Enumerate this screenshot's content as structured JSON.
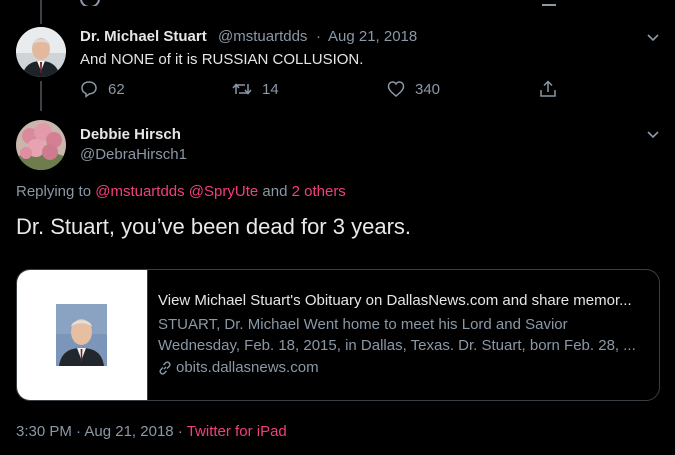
{
  "top_reply": {
    "name": "Dr. Michael Stuart",
    "handle": "@mstuartdds",
    "separator": "·",
    "date": "Aug 21, 2018",
    "text": "And NONE of it is RUSSIAN COLLUSION.",
    "reply_count": "62",
    "retweet_count": "14",
    "like_count": "340"
  },
  "main_tweet": {
    "name": "Debbie Hirsch",
    "handle": "@DebraHirsch1",
    "replying_prefix": "Replying to",
    "replying_users": "@mstuartdds @SpryUte",
    "replying_and": "and",
    "replying_others": "2 others",
    "text": "Dr. Stuart, you’ve been dead for 3 years.",
    "card": {
      "title": "View Michael Stuart's Obituary on DallasNews.com and share memor...",
      "desc_line1": "STUART, Dr. Michael Went home to meet his Lord and Savior",
      "desc_line2": "Wednesday, Feb. 18, 2015, in Dallas, Texas. Dr. Stuart, born Feb. 28, ...",
      "domain": "obits.dallasnews.com"
    },
    "time": "3:30 PM",
    "separator": "·",
    "date": "Aug 21, 2018",
    "separator2": "·",
    "source": "Twitter for iPad"
  },
  "colors": {
    "background": "#000000",
    "accent": "#f0407a",
    "muted": "#8b98a5"
  }
}
